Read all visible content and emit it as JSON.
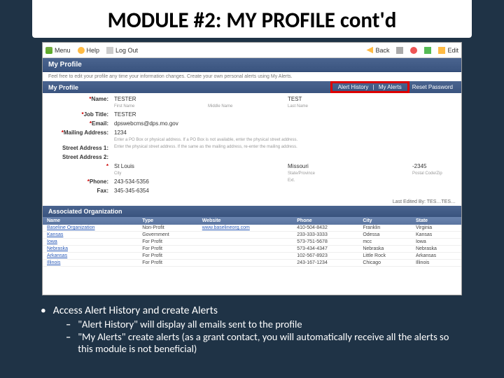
{
  "slide_title": "MODULE #2:  MY PROFILE cont'd",
  "toolbar": {
    "menu": "Menu",
    "help": "Help",
    "logout": "Log Out",
    "back": "Back",
    "print": "",
    "delete": "",
    "save": "",
    "edit": "Edit"
  },
  "banner": "My Profile",
  "desc": "Feel free to edit your profile any time your information changes. Create your own personal alerts using My Alerts.",
  "sub_header": "My Profile",
  "sub_links": {
    "alert_history": "Alert History",
    "my_alerts": "My Alerts",
    "reset_pw": "Reset Password"
  },
  "form": {
    "name_lbl": "Name:",
    "name_val": "TESTER",
    "name_mid": "",
    "name_last": "TEST",
    "name_f_sub": "First Name",
    "name_m_sub": "Middle Name",
    "name_l_sub": "Last Name",
    "title_lbl": "Job Title:",
    "title_val": "TESTER",
    "email_lbl": "Email:",
    "email_val": "dpswebcms@dps.mo.gov",
    "mail_lbl": "Mailing Address:",
    "mail_val": "1234",
    "mail_hint": "Enter a PO Box or physical address. If a PO Box is not available, enter the physical street address.",
    "street_lbl": "Street Address 1:",
    "street_hint": "Enter the physical street address. If the same as the mailing address, re-enter the mailing address.",
    "street2_lbl": "Street Address 2:",
    "city_lbl": "",
    "city_val": "St Louis",
    "state_val": "Missouri",
    "zip_val": "-2345",
    "city_sub": "City",
    "state_sub": "State/Province",
    "zip_sub": "Postal Code/Zip",
    "phone_lbl": "Phone:",
    "phone_val": "243-534-5356",
    "phone_ext_sub": "Ext.",
    "fax_lbl": "Fax:",
    "fax_val": "345-345-6354"
  },
  "last_edited": "Last Edited By: TES…TES…",
  "org_header": "Associated Organization",
  "org_cols": [
    "Name",
    "Type",
    "Website",
    "Phone",
    "City",
    "State"
  ],
  "org_rows": [
    {
      "name": "Baseline Organization",
      "type": "Non-Profit",
      "web": "www.baselineorg.com",
      "phone": "410-504-8432",
      "city": "Franklin",
      "state": "Virginia"
    },
    {
      "name": "Kansas",
      "type": "Government",
      "web": "",
      "phone": "233-333-3333",
      "city": "Odessa",
      "state": "Kansas"
    },
    {
      "name": "Iowa",
      "type": "For Profit",
      "web": "",
      "phone": "573-751-5678",
      "city": "mcc",
      "state": "Iowa"
    },
    {
      "name": "Nebraska",
      "type": "For Profit",
      "web": "",
      "phone": "573-434-4347",
      "city": "Nebraska",
      "state": "Nebraska"
    },
    {
      "name": "Arkansas",
      "type": "For Profit",
      "web": "",
      "phone": "102-567-8923",
      "city": "Little Rock",
      "state": "Arkansas"
    },
    {
      "name": "Illinois",
      "type": "For Profit",
      "web": "",
      "phone": "243-167-1234",
      "city": "Chicago",
      "state": "Illinois"
    }
  ],
  "bullets": {
    "b1": "Access Alert History and create Alerts",
    "b2a": "\"Alert History\" will display all emails sent to the profile",
    "b2b": "\"My Alerts\" create alerts (as a grant contact, you will automatically receive all the alerts so this module is not beneficial)"
  }
}
